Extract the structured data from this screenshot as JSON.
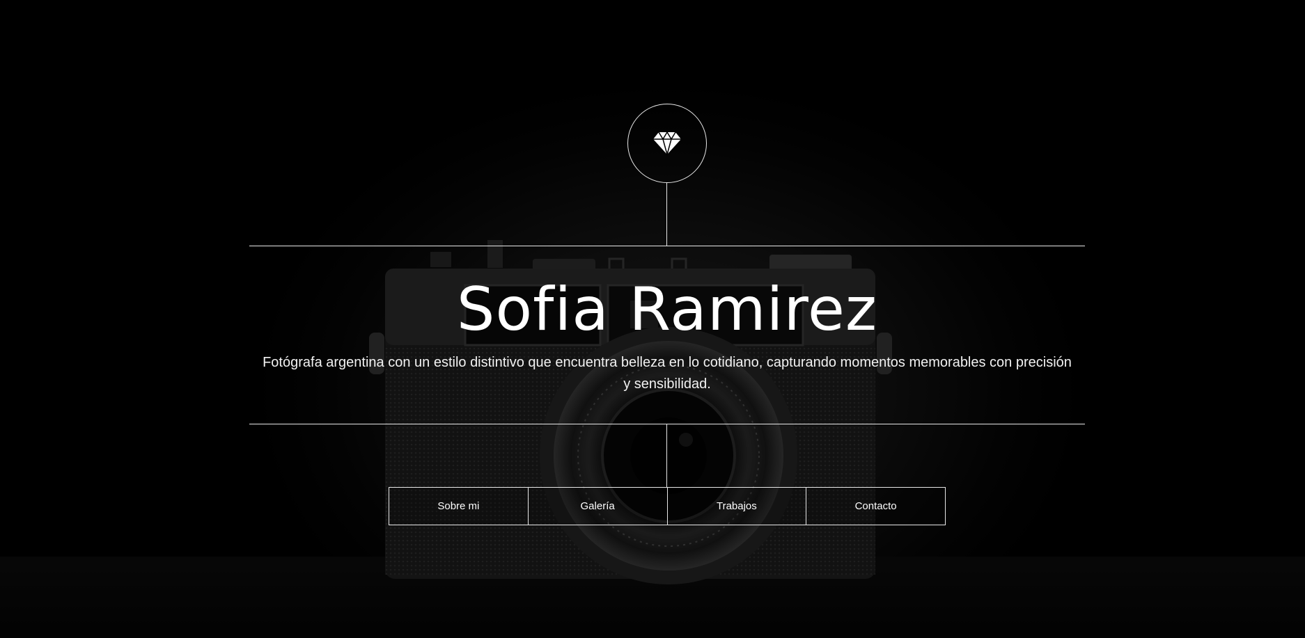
{
  "hero": {
    "logo_icon": "diamond-icon",
    "title": "Sofia Ramirez",
    "subtitle": "Fotógrafa argentina con un estilo distintivo que encuentra belleza en lo cotidiano, capturando momentos memorables con precisión y sensibilidad."
  },
  "nav": {
    "items": [
      {
        "label": "Sobre mi"
      },
      {
        "label": "Galería"
      },
      {
        "label": "Trabajos"
      },
      {
        "label": "Contacto"
      }
    ]
  },
  "colors": {
    "background": "#000000",
    "text": "#ffffff",
    "lines": "#e8e8e8"
  }
}
